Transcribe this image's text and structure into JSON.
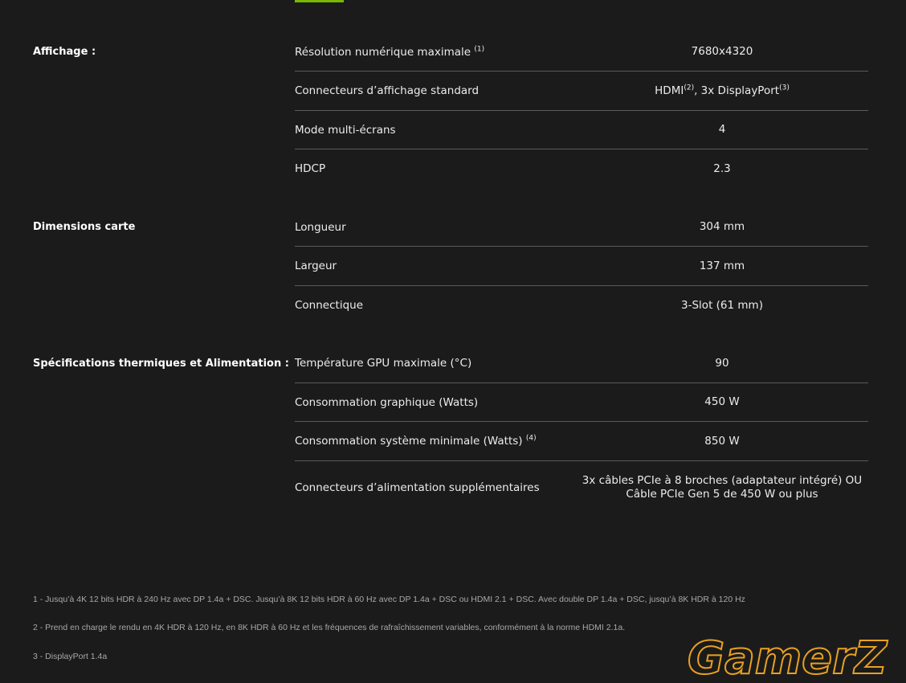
{
  "sections": [
    {
      "title": "Affichage :",
      "rows": [
        {
          "label": "Résolution numérique maximale",
          "label_sup": "(1)",
          "value": "7680x4320"
        },
        {
          "label": "Connecteurs d’affichage standard",
          "value_a": "HDMI",
          "value_a_sup": "(2)",
          "value_b": ", 3x DisplayPort",
          "value_b_sup": "(3)"
        },
        {
          "label": "Mode multi-écrans",
          "value": "4"
        },
        {
          "label": "HDCP",
          "value": "2.3"
        }
      ]
    },
    {
      "title": "Dimensions carte",
      "rows": [
        {
          "label": "Longueur",
          "value": "304 mm"
        },
        {
          "label": "Largeur",
          "value": "137 mm"
        },
        {
          "label": "Connectique",
          "value": "3-Slot (61 mm)"
        }
      ]
    },
    {
      "title": "Spécifications thermiques et Alimentation :",
      "rows": [
        {
          "label": "Température GPU maximale (°C)",
          "value": "90"
        },
        {
          "label": "Consommation graphique (Watts)",
          "value": "450 W"
        },
        {
          "label": "Consommation système minimale (Watts)",
          "label_sup": "(4)",
          "value": "850 W"
        },
        {
          "label": "Connecteurs d’alimentation supplémentaires",
          "value_line1": "3x câbles PCIe à 8 broches (adaptateur intégré) OU",
          "value_line2": "Câble PCIe Gen 5 de 450 W ou plus"
        }
      ]
    }
  ],
  "footnotes": [
    "1 - Jusqu’à 4K 12 bits HDR à 240 Hz avec DP 1.4a + DSC. Jusqu’à 8K 12 bits HDR à 60 Hz avec DP 1.4a + DSC ou HDMI 2.1 + DSC. Avec double DP 1.4a + DSC, jusqu’à 8K HDR à 120 Hz",
    "2 - Prend en charge le rendu en 4K HDR à 120 Hz, en 8K HDR à 60 Hz et les fréquences de rafraîchissement variables, conformément à la norme HDMI 2.1a.",
    "3 - DisplayPort 1.4a"
  ],
  "watermark": {
    "text": "GamerZ",
    "color": "#e8a020"
  },
  "colors": {
    "background": "#1b1b1b",
    "accent": "#76b900",
    "divider": "#5a5a5a"
  }
}
